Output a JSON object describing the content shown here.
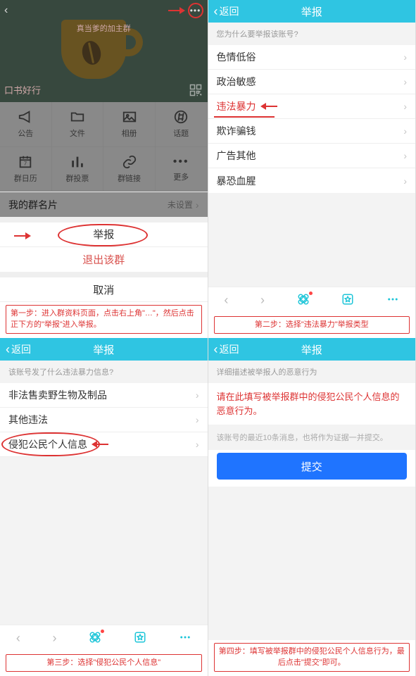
{
  "p1": {
    "hero_title": "口书好行",
    "banner_text": "真当爹的加主群",
    "grid": [
      {
        "label": "公告"
      },
      {
        "label": "文件"
      },
      {
        "label": "相册"
      },
      {
        "label": "话题"
      },
      {
        "label": "群日历"
      },
      {
        "label": "群投票"
      },
      {
        "label": "群链接"
      },
      {
        "label": "更多"
      }
    ],
    "namecard_label": "我的群名片",
    "namecard_value": "未设置",
    "sheet": {
      "report": "举报",
      "quit": "退出该群",
      "cancel": "取消"
    },
    "caption": "第一步：进入群资料页面，点击右上角\"…\"，然后点击正下方的\"举报\"进入举报。"
  },
  "p2": {
    "back": "返回",
    "title": "举报",
    "prompt": "您为什么要举报该账号?",
    "options": [
      "色情低俗",
      "政治敏感",
      "违法暴力",
      "欺诈骗钱",
      "广告其他",
      "暴恐血腥"
    ],
    "caption": "第二步：选择\"违法暴力\"举报类型"
  },
  "p3": {
    "back": "返回",
    "title": "举报",
    "prompt": "该账号发了什么违法暴力信息?",
    "options": [
      "非法售卖野生物及制品",
      "其他违法",
      "侵犯公民个人信息"
    ],
    "caption": "第三步：选择\"侵犯公民个人信息\""
  },
  "p4": {
    "back": "返回",
    "title": "举报",
    "prompt": "详细描述被举报人的恶意行为",
    "textarea": "请在此填写被举报群中的侵犯公民个人信息的恶意行为。",
    "hint": "该账号的最近10条消息，也将作为证据一并提交。",
    "submit": "提交",
    "caption": "第四步：填写被举报群中的侵犯公民个人信息行为，最后点击\"提交\"即可。"
  }
}
